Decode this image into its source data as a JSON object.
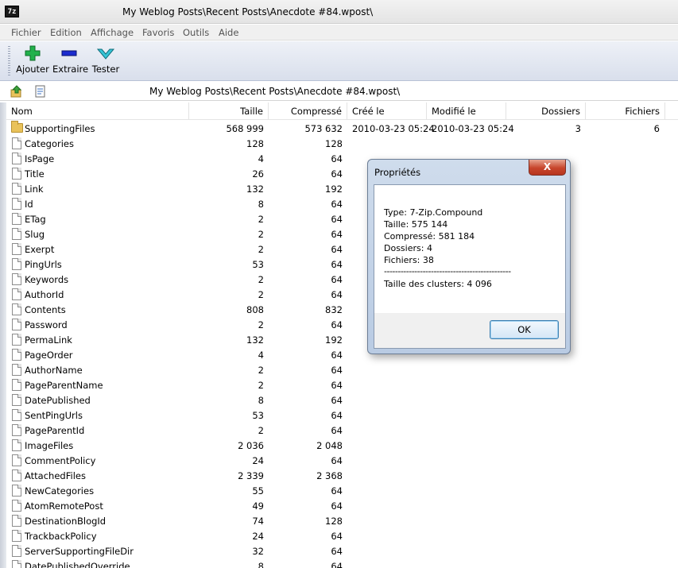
{
  "window": {
    "title": "My Weblog Posts\\Recent Posts\\Anecdote #84.wpost\\",
    "app_icon_text": "7z"
  },
  "menu": {
    "items": [
      "Fichier",
      "Edition",
      "Affichage",
      "Favoris",
      "Outils",
      "Aide"
    ]
  },
  "toolbar": {
    "buttons": [
      {
        "label": "Ajouter",
        "icon": "plus-icon",
        "color": "#22b14c"
      },
      {
        "label": "Extraire",
        "icon": "minus-icon",
        "color": "#1c2ccf"
      },
      {
        "label": "Tester",
        "icon": "check-chevron-icon",
        "color": "#35c4d6"
      }
    ]
  },
  "address": {
    "path": "My Weblog Posts\\Recent Posts\\Anecdote #84.wpost\\"
  },
  "columns": [
    "Nom",
    "Taille",
    "Compressé",
    "Créé le",
    "Modifié le",
    "Dossiers",
    "Fichiers"
  ],
  "rows": [
    {
      "name": "SupportingFiles",
      "size": "568 999",
      "packed": "573 632",
      "created": "2010-03-23 05:24",
      "modified": "2010-03-23 05:24",
      "folders": "3",
      "files": "6",
      "folder": true
    },
    {
      "name": "Categories",
      "size": "128",
      "packed": "128"
    },
    {
      "name": "IsPage",
      "size": "4",
      "packed": "64"
    },
    {
      "name": "Title",
      "size": "26",
      "packed": "64"
    },
    {
      "name": "Link",
      "size": "132",
      "packed": "192"
    },
    {
      "name": "Id",
      "size": "8",
      "packed": "64"
    },
    {
      "name": "ETag",
      "size": "2",
      "packed": "64"
    },
    {
      "name": "Slug",
      "size": "2",
      "packed": "64"
    },
    {
      "name": "Exerpt",
      "size": "2",
      "packed": "64"
    },
    {
      "name": "PingUrls",
      "size": "53",
      "packed": "64"
    },
    {
      "name": "Keywords",
      "size": "2",
      "packed": "64"
    },
    {
      "name": "AuthorId",
      "size": "2",
      "packed": "64"
    },
    {
      "name": "Contents",
      "size": "808",
      "packed": "832"
    },
    {
      "name": "Password",
      "size": "2",
      "packed": "64"
    },
    {
      "name": "PermaLink",
      "size": "132",
      "packed": "192"
    },
    {
      "name": "PageOrder",
      "size": "4",
      "packed": "64"
    },
    {
      "name": "AuthorName",
      "size": "2",
      "packed": "64"
    },
    {
      "name": "PageParentName",
      "size": "2",
      "packed": "64"
    },
    {
      "name": "DatePublished",
      "size": "8",
      "packed": "64"
    },
    {
      "name": "SentPingUrls",
      "size": "53",
      "packed": "64"
    },
    {
      "name": "PageParentId",
      "size": "2",
      "packed": "64"
    },
    {
      "name": "ImageFiles",
      "size": "2 036",
      "packed": "2 048"
    },
    {
      "name": "CommentPolicy",
      "size": "24",
      "packed": "64"
    },
    {
      "name": "AttachedFiles",
      "size": "2 339",
      "packed": "2 368"
    },
    {
      "name": "NewCategories",
      "size": "55",
      "packed": "64"
    },
    {
      "name": "AtomRemotePost",
      "size": "49",
      "packed": "64"
    },
    {
      "name": "DestinationBlogId",
      "size": "74",
      "packed": "128"
    },
    {
      "name": "TrackbackPolicy",
      "size": "24",
      "packed": "64"
    },
    {
      "name": "ServerSupportingFileDir",
      "size": "32",
      "packed": "64"
    },
    {
      "name": "DatePublishedOverride",
      "size": "8",
      "packed": "64"
    }
  ],
  "dialog": {
    "title": "Propriétés",
    "close_glyph": "X",
    "lines": [
      "Type: 7-Zip.Compound",
      "Taille: 575 144",
      "Compressé: 581 184",
      "Dossiers: 4",
      "Fichiers: 38",
      "----------------------------------------------",
      "Taille des clusters: 4 096"
    ],
    "ok_label": "OK"
  }
}
